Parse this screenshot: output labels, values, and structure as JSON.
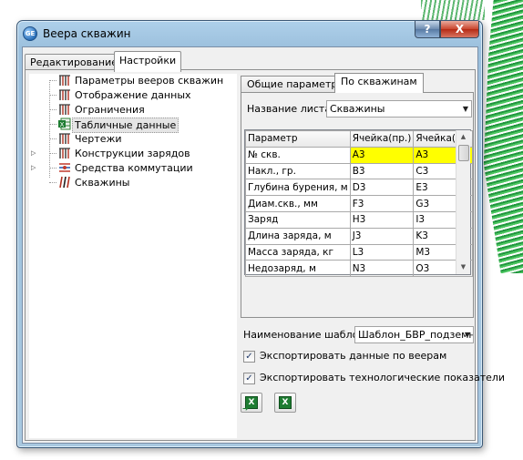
{
  "window": {
    "title": "Веера скважин",
    "help_label": "?",
    "close_label": "X"
  },
  "tabs": [
    {
      "label": "Редактирование"
    },
    {
      "label": "Настройки"
    }
  ],
  "tree": {
    "items": [
      {
        "label": "Параметры вееров скважин",
        "icon": "fan-wells-icon"
      },
      {
        "label": "Отображение данных",
        "icon": "fan-wells-icon"
      },
      {
        "label": "Ограничения",
        "icon": "fan-wells-icon"
      },
      {
        "label": "Табличные данные",
        "icon": "excel-icon",
        "selected": true
      },
      {
        "label": "Чертежи",
        "icon": "fan-wells-icon"
      },
      {
        "label": "Конструкции зарядов",
        "icon": "fan-wells-icon",
        "expandable": true
      },
      {
        "label": "Средства коммутации",
        "icon": "commutation-icon",
        "expandable": true
      },
      {
        "label": "Скважины",
        "icon": "wells-icon"
      }
    ]
  },
  "right_tabs": [
    {
      "label": "Общие параметры"
    },
    {
      "label": "По скважинам"
    }
  ],
  "sheet": {
    "label": "Название листа",
    "value": "Скважины"
  },
  "grid": {
    "headers": [
      "Параметр",
      "Ячейка(пр.)",
      "Ячейка(ф.)"
    ],
    "rows": [
      {
        "param": "№ скв.",
        "plan": "A3",
        "fact": "A3",
        "highlight": true
      },
      {
        "param": "Накл., гр.",
        "plan": "B3",
        "fact": "C3"
      },
      {
        "param": "Глубина бурения, м",
        "plan": "D3",
        "fact": "E3"
      },
      {
        "param": "Диам.скв., мм",
        "plan": "F3",
        "fact": "G3"
      },
      {
        "param": "Заряд",
        "plan": "H3",
        "fact": "I3"
      },
      {
        "param": "Длина заряда, м",
        "plan": "J3",
        "fact": "K3"
      },
      {
        "param": "Масса заряда, кг",
        "plan": "L3",
        "fact": "M3"
      },
      {
        "param": "Недозаряд, м",
        "plan": "N3",
        "fact": "O3"
      }
    ]
  },
  "template": {
    "label": "Наименование шаблона",
    "value": "Шаблон_БВР_подземн"
  },
  "checkboxes": [
    {
      "label": "Экспортировать данные по веерам",
      "checked": true
    },
    {
      "label": "Экспортировать технологические показатели",
      "checked": true
    }
  ],
  "colors": {
    "highlight": "#ffff00",
    "excel_green": "#1e7d32",
    "title_blue": "#aed0ea",
    "close_red": "#c9452e"
  }
}
